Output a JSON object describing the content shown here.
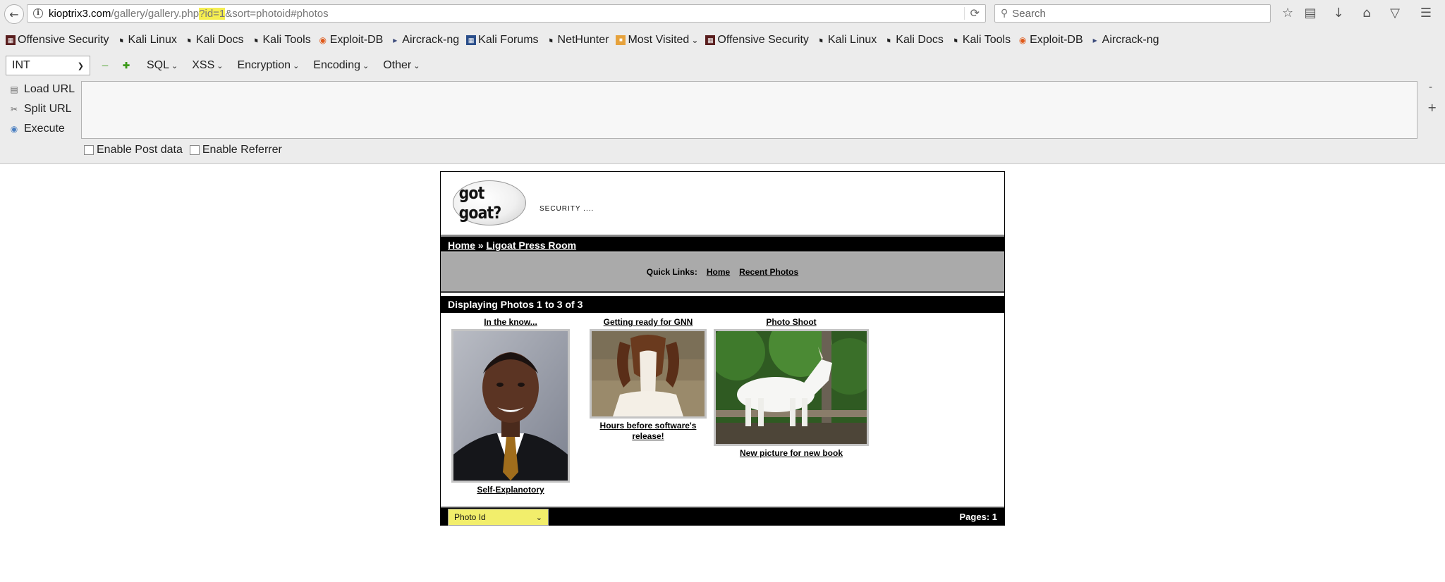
{
  "browser": {
    "url": {
      "host": "kioptrix3.com",
      "path_before": "/gallery/gallery.php",
      "highlight": "?id=1",
      "path_after": "&sort=photoid#photos"
    },
    "search_placeholder": "Search"
  },
  "bookmarks": [
    {
      "label": "Offensive Security",
      "icon": "offsec-icon"
    },
    {
      "label": "Kali Linux",
      "icon": "kali-icon"
    },
    {
      "label": "Kali Docs",
      "icon": "kali-icon"
    },
    {
      "label": "Kali Tools",
      "icon": "kali-icon"
    },
    {
      "label": "Exploit-DB",
      "icon": "exploitdb-icon"
    },
    {
      "label": "Aircrack-ng",
      "icon": "aircrack-icon"
    },
    {
      "label": "Kali Forums",
      "icon": "forums-icon"
    },
    {
      "label": "NetHunter",
      "icon": "kali-icon"
    },
    {
      "label": "Most Visited",
      "icon": "folder-icon"
    },
    {
      "label": "Offensive Security",
      "icon": "offsec-icon"
    },
    {
      "label": "Kali Linux",
      "icon": "kali-icon"
    },
    {
      "label": "Kali Docs",
      "icon": "kali-icon"
    },
    {
      "label": "Kali Tools",
      "icon": "kali-icon"
    },
    {
      "label": "Exploit-DB",
      "icon": "exploitdb-icon"
    },
    {
      "label": "Aircrack-ng",
      "icon": "aircrack-icon"
    }
  ],
  "hackbar": {
    "type_select": "INT",
    "menus": [
      "SQL",
      "XSS",
      "Encryption",
      "Encoding",
      "Other"
    ],
    "load_url": "Load URL",
    "split_url": "Split URL",
    "execute": "Execute",
    "minus": "-",
    "plus": "+",
    "enable_post": "Enable Post data",
    "enable_referrer": "Enable Referrer"
  },
  "site": {
    "logo_text": "got goat?",
    "tagline": "SECURITY ....",
    "breadcrumb": {
      "home": "Home",
      "separator": "»",
      "current": "Ligoat Press Room"
    },
    "quick_links_label": "Quick Links:",
    "quick_links": [
      "Home",
      "Recent Photos"
    ],
    "displaying": "Displaying Photos 1 to 3 of 3",
    "photos": [
      {
        "title": "In the know...",
        "caption": "Self-Explanotory"
      },
      {
        "title": "Getting ready for GNN",
        "caption": "Hours before software's release!"
      },
      {
        "title": "Photo Shoot",
        "caption": "New picture for new book"
      }
    ],
    "sort_select": "Photo Id",
    "pages": "Pages: 1"
  }
}
